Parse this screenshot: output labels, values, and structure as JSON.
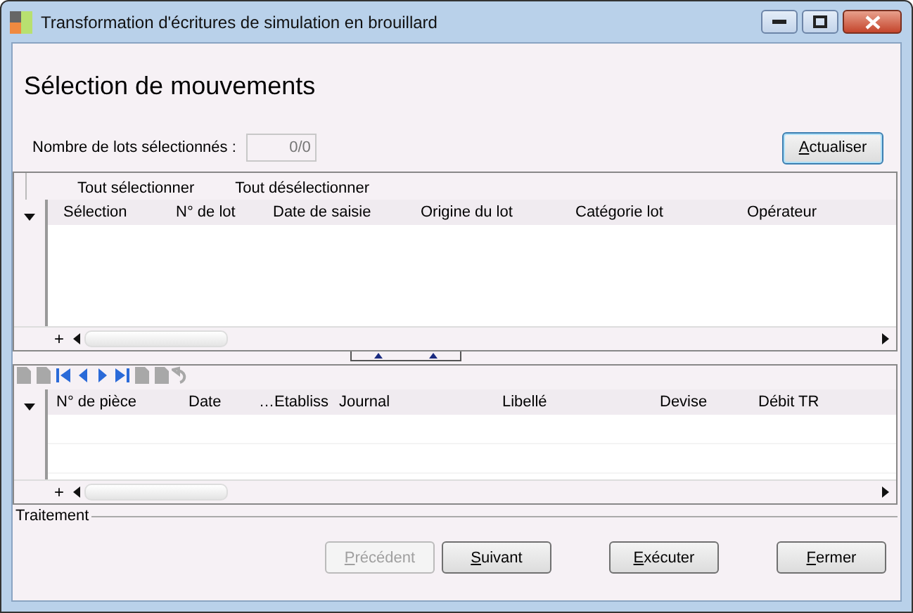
{
  "window": {
    "title": "Transformation d'écritures de simulation en brouillard"
  },
  "heading": "Sélection de mouvements",
  "count": {
    "label": "Nombre de lots sélectionnés :",
    "value": "0/0"
  },
  "refresh_button": "Actualiser",
  "batches": {
    "actions": [
      "Tout sélectionner",
      "Tout désélectionner"
    ],
    "columns": [
      "Sélection",
      "N° de lot",
      "Date de saisie",
      "Origine du lot",
      "Catégorie lot",
      "Opérateur"
    ],
    "add": "+"
  },
  "entries": {
    "columns": [
      "N° de pièce",
      "Date",
      "…Etabliss",
      "Journal",
      "Libellé",
      "Devise",
      "Débit TR"
    ],
    "add": "+"
  },
  "processing": {
    "label": "Traitement"
  },
  "buttons": [
    {
      "label": "Précédent",
      "disabled": true
    },
    {
      "label": "Suivant",
      "disabled": false
    },
    {
      "label": "Exécuter",
      "disabled": false
    },
    {
      "label": "Fermer",
      "disabled": false
    }
  ]
}
